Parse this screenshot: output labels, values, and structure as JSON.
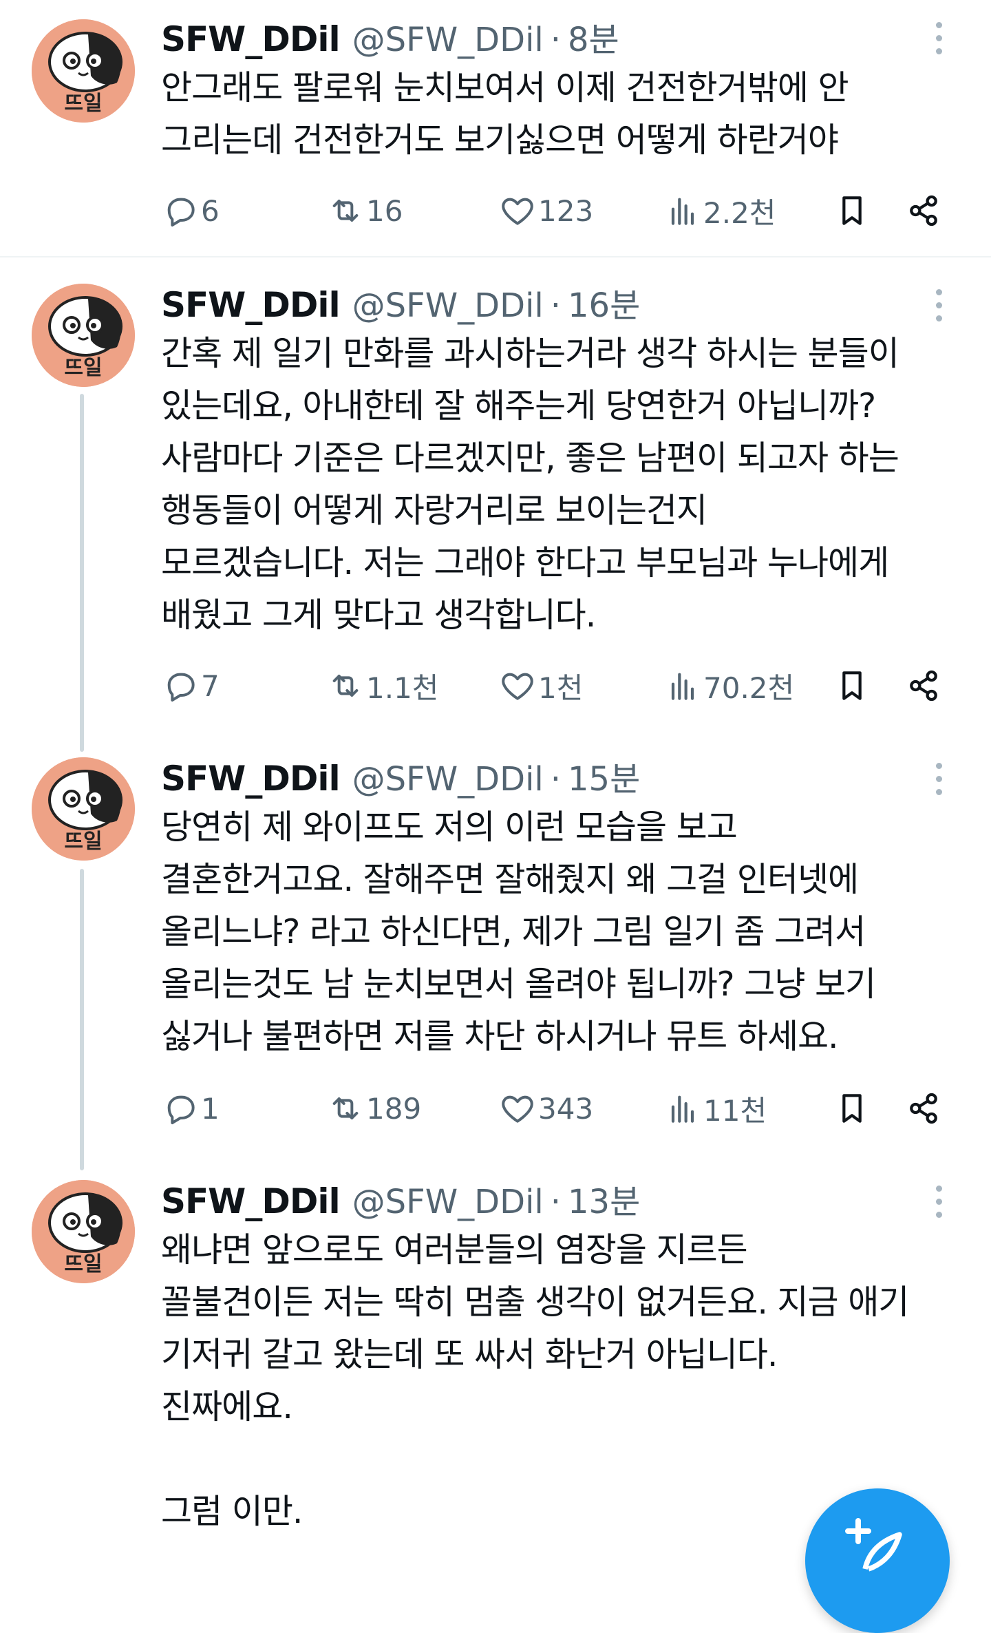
{
  "tweets": [
    {
      "name": "SFW_DDil",
      "handle": "@SFW_DDil",
      "dot": "·",
      "time": "8분",
      "lines": [
        "안그래도 팔로워 눈치보여서 이제 건전한거밖에 안",
        "그리는데 건전한거도 보기싫으면 어떻게 하란거야"
      ],
      "stats": {
        "replies": "6",
        "retweets": "16",
        "likes": "123",
        "views": "2.2천"
      }
    },
    {
      "name": "SFW_DDil",
      "handle": "@SFW_DDil",
      "dot": "·",
      "time": "16분",
      "lines": [
        "간혹 제 일기 만화를 과시하는거라 생각 하시는 분들이",
        "있는데요, 아내한테 잘 해주는게 당연한거 아닙니까?",
        "사람마다 기준은 다르겠지만, 좋은 남편이 되고자 하는",
        "행동들이 어떻게 자랑거리로 보이는건지",
        "모르겠습니다. 저는 그래야 한다고 부모님과 누나에게",
        "배웠고 그게 맞다고 생각합니다."
      ],
      "stats": {
        "replies": "7",
        "retweets": "1.1천",
        "likes": "1천",
        "views": "70.2천"
      }
    },
    {
      "name": "SFW_DDil",
      "handle": "@SFW_DDil",
      "dot": "·",
      "time": "15분",
      "lines": [
        "당연히 제 와이프도 저의 이런 모습을 보고",
        "결혼한거고요. 잘해주면 잘해줬지 왜 그걸 인터넷에",
        "올리느냐? 라고 하신다면, 제가 그림 일기 좀 그려서",
        "올리는것도 남 눈치보면서 올려야 됩니까? 그냥 보기",
        "싫거나 불편하면 저를 차단 하시거나 뮤트 하세요."
      ],
      "stats": {
        "replies": "1",
        "retweets": "189",
        "likes": "343",
        "views": "11천"
      }
    },
    {
      "name": "SFW_DDil",
      "handle": "@SFW_DDil",
      "dot": "·",
      "time": "13분",
      "lines": [
        "왜냐면 앞으로도 여러분들의 염장을 지르든",
        "꼴불견이든 저는 딱히 멈출 생각이 없거든요. 지금 애기",
        "기저귀 갈고 왔는데 또 싸서 화난거 아닙니다.",
        "진짜에요.",
        "",
        "그럼 이만."
      ]
    }
  ],
  "avatar": {
    "label": "뜨일",
    "bg": "#eea286"
  },
  "icons": {
    "reply": "reply-icon",
    "retweet": "retweet-icon",
    "like": "heart-icon",
    "views": "views-icon",
    "bookmark": "bookmark-icon",
    "share": "share-icon",
    "more": "more-icon",
    "compose": "compose-icon"
  },
  "colors": {
    "accent": "#1d9bf0",
    "muted": "#536471",
    "text": "#0f1419",
    "divider": "#eff3f4"
  }
}
